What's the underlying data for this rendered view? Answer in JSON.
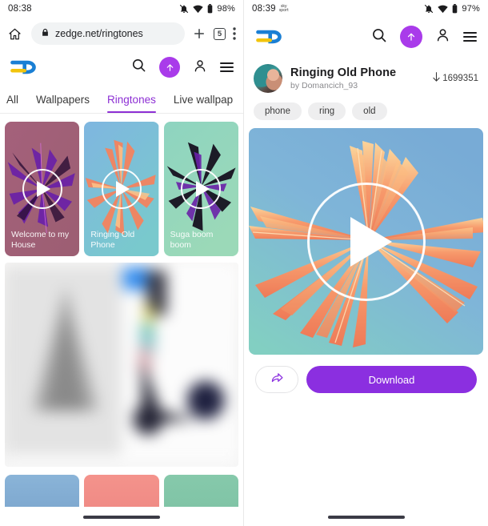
{
  "colors": {
    "purple": "#8b2fe0",
    "purple_accent": "#a93bea",
    "tab_active": "#8d2fd4",
    "logo_blue": "#1a7fd4",
    "logo_yellow": "#f2c40c"
  },
  "left": {
    "status": {
      "time": "08:38",
      "battery": "98%",
      "icons": [
        "notifications-off-icon",
        "wifi-icon",
        "battery-icon"
      ]
    },
    "browser": {
      "home_icon": "home-icon",
      "lock_icon": "lock-icon",
      "url": "zedge.net/ringtones",
      "new_tab_icon": "plus-icon",
      "tab_count": "5",
      "menu_icon": "kebab-menu-icon"
    },
    "appbar": {
      "logo": "zedge-logo",
      "search_icon": "search-icon",
      "upload_icon": "upload-arrow-icon",
      "account_icon": "person-icon",
      "menu_icon": "hamburger-icon"
    },
    "tabs": [
      {
        "label": "All",
        "active": false
      },
      {
        "label": "Wallpapers",
        "active": false
      },
      {
        "label": "Ringtones",
        "active": true
      },
      {
        "label": "Live wallpap",
        "active": false
      }
    ],
    "cards": [
      {
        "title": "Welcome to my House",
        "play_icon": "play-icon"
      },
      {
        "title": "Ringing Old Phone",
        "play_icon": "play-icon"
      },
      {
        "title": "Suga boom boom",
        "play_icon": "play-icon"
      }
    ],
    "ad": {
      "name": "blurred-ad-banner"
    },
    "bottom_cards": [
      "card-blue",
      "card-coral",
      "card-green"
    ]
  },
  "right": {
    "status": {
      "time": "08:39",
      "battery": "97%",
      "icons": [
        "notifications-off-icon",
        "wifi-icon",
        "battery-icon"
      ]
    },
    "appbar": {
      "logo": "zedge-logo",
      "search_icon": "search-icon",
      "upload_icon": "upload-arrow-icon",
      "account_icon": "person-icon",
      "menu_icon": "hamburger-icon"
    },
    "detail": {
      "title": "Ringing Old Phone",
      "byline": "by Domancich_93",
      "download_count": "1699351",
      "download_icon": "download-arrow-icon",
      "avatar": "author-avatar",
      "tags": [
        "phone",
        "ring",
        "old"
      ],
      "preview": {
        "name": "ringtone-preview",
        "play_icon": "play-icon"
      },
      "share_label": "share-icon",
      "download_label": "Download"
    }
  }
}
